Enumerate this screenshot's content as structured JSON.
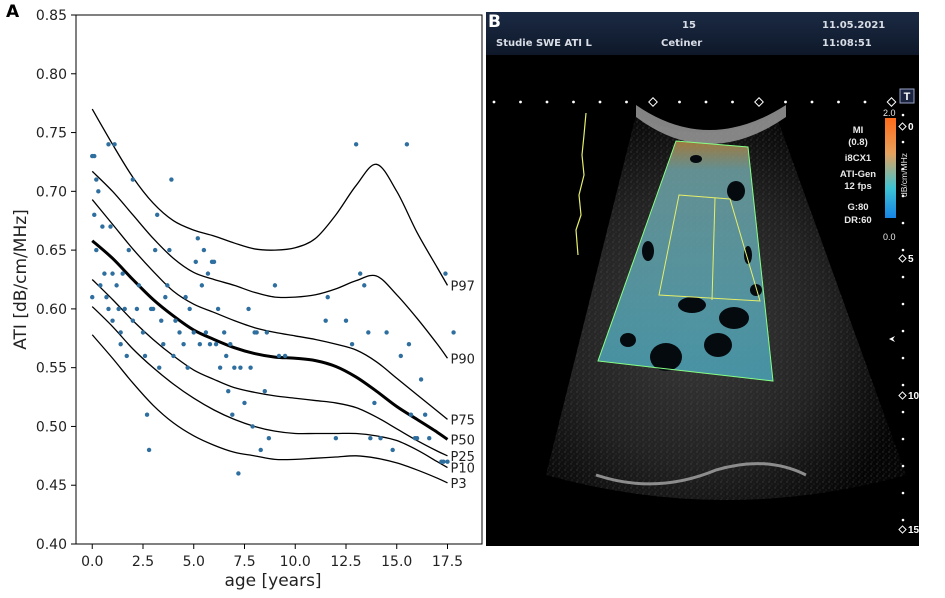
{
  "panel_a": {
    "letter": "A",
    "chart_data": {
      "type": "scatter",
      "xlabel": "age [years]",
      "ylabel": "ATI [dB/cm/MHz]",
      "xlim": [
        -0.8,
        19.2
      ],
      "ylim": [
        0.4,
        0.85
      ],
      "xticks": [
        0.0,
        2.5,
        5.0,
        7.5,
        10.0,
        12.5,
        15.0,
        17.5
      ],
      "xtick_labels": [
        "0.0",
        "2.5",
        "5.0",
        "7.5",
        "10.0",
        "12.5",
        "15.0",
        "17.5"
      ],
      "yticks": [
        0.4,
        0.45,
        0.5,
        0.55,
        0.6,
        0.65,
        0.7,
        0.75,
        0.8,
        0.85
      ],
      "ytick_labels": [
        "0.40",
        "0.45",
        "0.50",
        "0.55",
        "0.60",
        "0.65",
        "0.70",
        "0.75",
        "0.80",
        "0.85"
      ],
      "grid": false,
      "point_color": "#2f6f9f",
      "points": [
        [
          0.0,
          0.73
        ],
        [
          0.1,
          0.73
        ],
        [
          0.2,
          0.71
        ],
        [
          0.1,
          0.68
        ],
        [
          0.3,
          0.7
        ],
        [
          0.2,
          0.65
        ],
        [
          0.0,
          0.61
        ],
        [
          0.4,
          0.62
        ],
        [
          0.5,
          0.67
        ],
        [
          0.6,
          0.63
        ],
        [
          0.7,
          0.61
        ],
        [
          0.8,
          0.6
        ],
        [
          0.8,
          0.74
        ],
        [
          0.9,
          0.67
        ],
        [
          1.0,
          0.59
        ],
        [
          1.0,
          0.63
        ],
        [
          1.1,
          0.74
        ],
        [
          1.2,
          0.62
        ],
        [
          1.3,
          0.6
        ],
        [
          1.4,
          0.58
        ],
        [
          1.4,
          0.57
        ],
        [
          1.5,
          0.63
        ],
        [
          1.6,
          0.6
        ],
        [
          1.7,
          0.56
        ],
        [
          1.8,
          0.65
        ],
        [
          2.0,
          0.71
        ],
        [
          2.0,
          0.59
        ],
        [
          2.2,
          0.6
        ],
        [
          2.3,
          0.62
        ],
        [
          2.5,
          0.58
        ],
        [
          2.6,
          0.56
        ],
        [
          2.7,
          0.51
        ],
        [
          2.8,
          0.48
        ],
        [
          2.9,
          0.6
        ],
        [
          3.0,
          0.6
        ],
        [
          3.1,
          0.65
        ],
        [
          3.2,
          0.68
        ],
        [
          3.3,
          0.55
        ],
        [
          3.4,
          0.59
        ],
        [
          3.5,
          0.57
        ],
        [
          3.6,
          0.61
        ],
        [
          3.7,
          0.62
        ],
        [
          3.8,
          0.65
        ],
        [
          3.9,
          0.71
        ],
        [
          4.0,
          0.56
        ],
        [
          4.1,
          0.59
        ],
        [
          4.3,
          0.58
        ],
        [
          4.5,
          0.57
        ],
        [
          4.6,
          0.61
        ],
        [
          4.7,
          0.55
        ],
        [
          4.8,
          0.6
        ],
        [
          5.0,
          0.58
        ],
        [
          5.1,
          0.64
        ],
        [
          5.2,
          0.66
        ],
        [
          5.3,
          0.57
        ],
        [
          5.4,
          0.62
        ],
        [
          5.5,
          0.65
        ],
        [
          5.6,
          0.58
        ],
        [
          5.7,
          0.63
        ],
        [
          5.8,
          0.57
        ],
        [
          5.9,
          0.64
        ],
        [
          6.0,
          0.64
        ],
        [
          6.1,
          0.57
        ],
        [
          6.2,
          0.6
        ],
        [
          6.3,
          0.55
        ],
        [
          6.5,
          0.58
        ],
        [
          6.6,
          0.56
        ],
        [
          6.7,
          0.53
        ],
        [
          6.8,
          0.57
        ],
        [
          6.9,
          0.51
        ],
        [
          7.0,
          0.55
        ],
        [
          7.2,
          0.46
        ],
        [
          7.3,
          0.55
        ],
        [
          7.5,
          0.52
        ],
        [
          7.7,
          0.6
        ],
        [
          7.8,
          0.55
        ],
        [
          7.9,
          0.5
        ],
        [
          8.0,
          0.58
        ],
        [
          8.1,
          0.58
        ],
        [
          8.3,
          0.48
        ],
        [
          8.5,
          0.53
        ],
        [
          8.6,
          0.58
        ],
        [
          8.7,
          0.49
        ],
        [
          9.0,
          0.62
        ],
        [
          9.2,
          0.56
        ],
        [
          9.5,
          0.56
        ],
        [
          11.5,
          0.59
        ],
        [
          11.6,
          0.61
        ],
        [
          12.0,
          0.49
        ],
        [
          12.5,
          0.59
        ],
        [
          12.8,
          0.57
        ],
        [
          13.0,
          0.74
        ],
        [
          13.2,
          0.63
        ],
        [
          13.4,
          0.62
        ],
        [
          13.6,
          0.58
        ],
        [
          13.7,
          0.49
        ],
        [
          13.9,
          0.52
        ],
        [
          14.2,
          0.49
        ],
        [
          14.5,
          0.58
        ],
        [
          14.8,
          0.48
        ],
        [
          15.2,
          0.56
        ],
        [
          15.5,
          0.74
        ],
        [
          15.6,
          0.57
        ],
        [
          15.7,
          0.51
        ],
        [
          15.9,
          0.49
        ],
        [
          16.0,
          0.49
        ],
        [
          16.2,
          0.54
        ],
        [
          16.4,
          0.51
        ],
        [
          16.6,
          0.49
        ],
        [
          17.2,
          0.47
        ],
        [
          17.3,
          0.47
        ],
        [
          17.4,
          0.63
        ],
        [
          17.5,
          0.47
        ],
        [
          17.8,
          0.58
        ]
      ],
      "series": [
        {
          "name": "P97",
          "line_width": 1.3,
          "x": [
            0,
            1,
            2,
            3,
            4,
            5,
            6,
            7,
            8,
            9,
            10,
            11,
            12,
            13,
            14,
            15,
            16,
            17,
            17.5
          ],
          "y": [
            0.77,
            0.74,
            0.712,
            0.69,
            0.675,
            0.667,
            0.662,
            0.656,
            0.651,
            0.65,
            0.652,
            0.66,
            0.68,
            0.705,
            0.723,
            0.7,
            0.665,
            0.635,
            0.62
          ]
        },
        {
          "name": "P90",
          "line_width": 1.3,
          "x": [
            0,
            1,
            2,
            3,
            4,
            5,
            6,
            7,
            8,
            9,
            10,
            11,
            12,
            13,
            14,
            15,
            16,
            17,
            17.5
          ],
          "y": [
            0.717,
            0.7,
            0.68,
            0.66,
            0.643,
            0.631,
            0.625,
            0.62,
            0.614,
            0.61,
            0.61,
            0.612,
            0.617,
            0.624,
            0.628,
            0.612,
            0.592,
            0.57,
            0.558
          ]
        },
        {
          "name": "P75",
          "line_width": 1.3,
          "x": [
            0,
            1,
            2,
            3,
            4,
            5,
            6,
            7,
            8,
            9,
            10,
            11,
            12,
            13,
            14,
            15,
            16,
            17,
            17.5
          ],
          "y": [
            0.693,
            0.672,
            0.651,
            0.632,
            0.615,
            0.604,
            0.597,
            0.59,
            0.584,
            0.58,
            0.577,
            0.574,
            0.57,
            0.565,
            0.555,
            0.541,
            0.527,
            0.513,
            0.506
          ]
        },
        {
          "name": "P50",
          "line_width": 3.0,
          "x": [
            0,
            1,
            2,
            3,
            4,
            5,
            6,
            7,
            8,
            9,
            10,
            11,
            12,
            13,
            14,
            15,
            16,
            17,
            17.5
          ],
          "y": [
            0.658,
            0.643,
            0.625,
            0.608,
            0.594,
            0.582,
            0.574,
            0.567,
            0.562,
            0.559,
            0.558,
            0.556,
            0.551,
            0.542,
            0.53,
            0.517,
            0.506,
            0.495,
            0.489
          ]
        },
        {
          "name": "P25",
          "line_width": 1.3,
          "x": [
            0,
            1,
            2,
            3,
            4,
            5,
            6,
            7,
            8,
            9,
            10,
            11,
            12,
            13,
            14,
            15,
            16,
            17,
            17.5
          ],
          "y": [
            0.625,
            0.608,
            0.59,
            0.574,
            0.56,
            0.548,
            0.54,
            0.533,
            0.529,
            0.526,
            0.524,
            0.522,
            0.52,
            0.516,
            0.508,
            0.498,
            0.488,
            0.479,
            0.475
          ]
        },
        {
          "name": "P10",
          "line_width": 1.3,
          "x": [
            0,
            1,
            2,
            3,
            4,
            5,
            6,
            7,
            8,
            9,
            10,
            11,
            12,
            13,
            14,
            15,
            16,
            17,
            17.5
          ],
          "y": [
            0.602,
            0.585,
            0.566,
            0.55,
            0.536,
            0.524,
            0.514,
            0.506,
            0.5,
            0.496,
            0.494,
            0.494,
            0.494,
            0.494,
            0.492,
            0.488,
            0.48,
            0.47,
            0.465
          ]
        },
        {
          "name": "P3",
          "line_width": 1.3,
          "x": [
            0,
            1,
            2,
            3,
            4,
            5,
            6,
            7,
            8,
            9,
            10,
            11,
            12,
            13,
            14,
            15,
            16,
            17,
            17.5
          ],
          "y": [
            0.578,
            0.558,
            0.537,
            0.518,
            0.503,
            0.492,
            0.484,
            0.478,
            0.475,
            0.472,
            0.472,
            0.473,
            0.474,
            0.475,
            0.473,
            0.469,
            0.463,
            0.456,
            0.452
          ]
        }
      ]
    }
  },
  "panel_b": {
    "letter": "B",
    "header": {
      "study": "Studie SWE ATI L",
      "frame": "15",
      "operator": "Cetiner",
      "date": "11.05.2021",
      "time": "11:08:51"
    },
    "colorbar": {
      "max_label": "2.0",
      "min_label": "0.0",
      "unit": "dB/cm/MHz",
      "colors": [
        "#ff6a1a",
        "#e7a15c",
        "#3ec3d3",
        "#1684e6"
      ]
    },
    "parameters": [
      "MI",
      "(0.8)",
      "i8CX1",
      "ATI-Gen",
      "12 fps",
      "G:80",
      "DR:60"
    ],
    "top_marker": "T",
    "depth_labels": [
      "0",
      "5",
      "10",
      "15"
    ],
    "colors": {
      "header_text": "#d9dde6",
      "roi_outline": "#86ff86",
      "measure_box": "#e6ef6a",
      "overlay": "#4fa6b4"
    }
  }
}
